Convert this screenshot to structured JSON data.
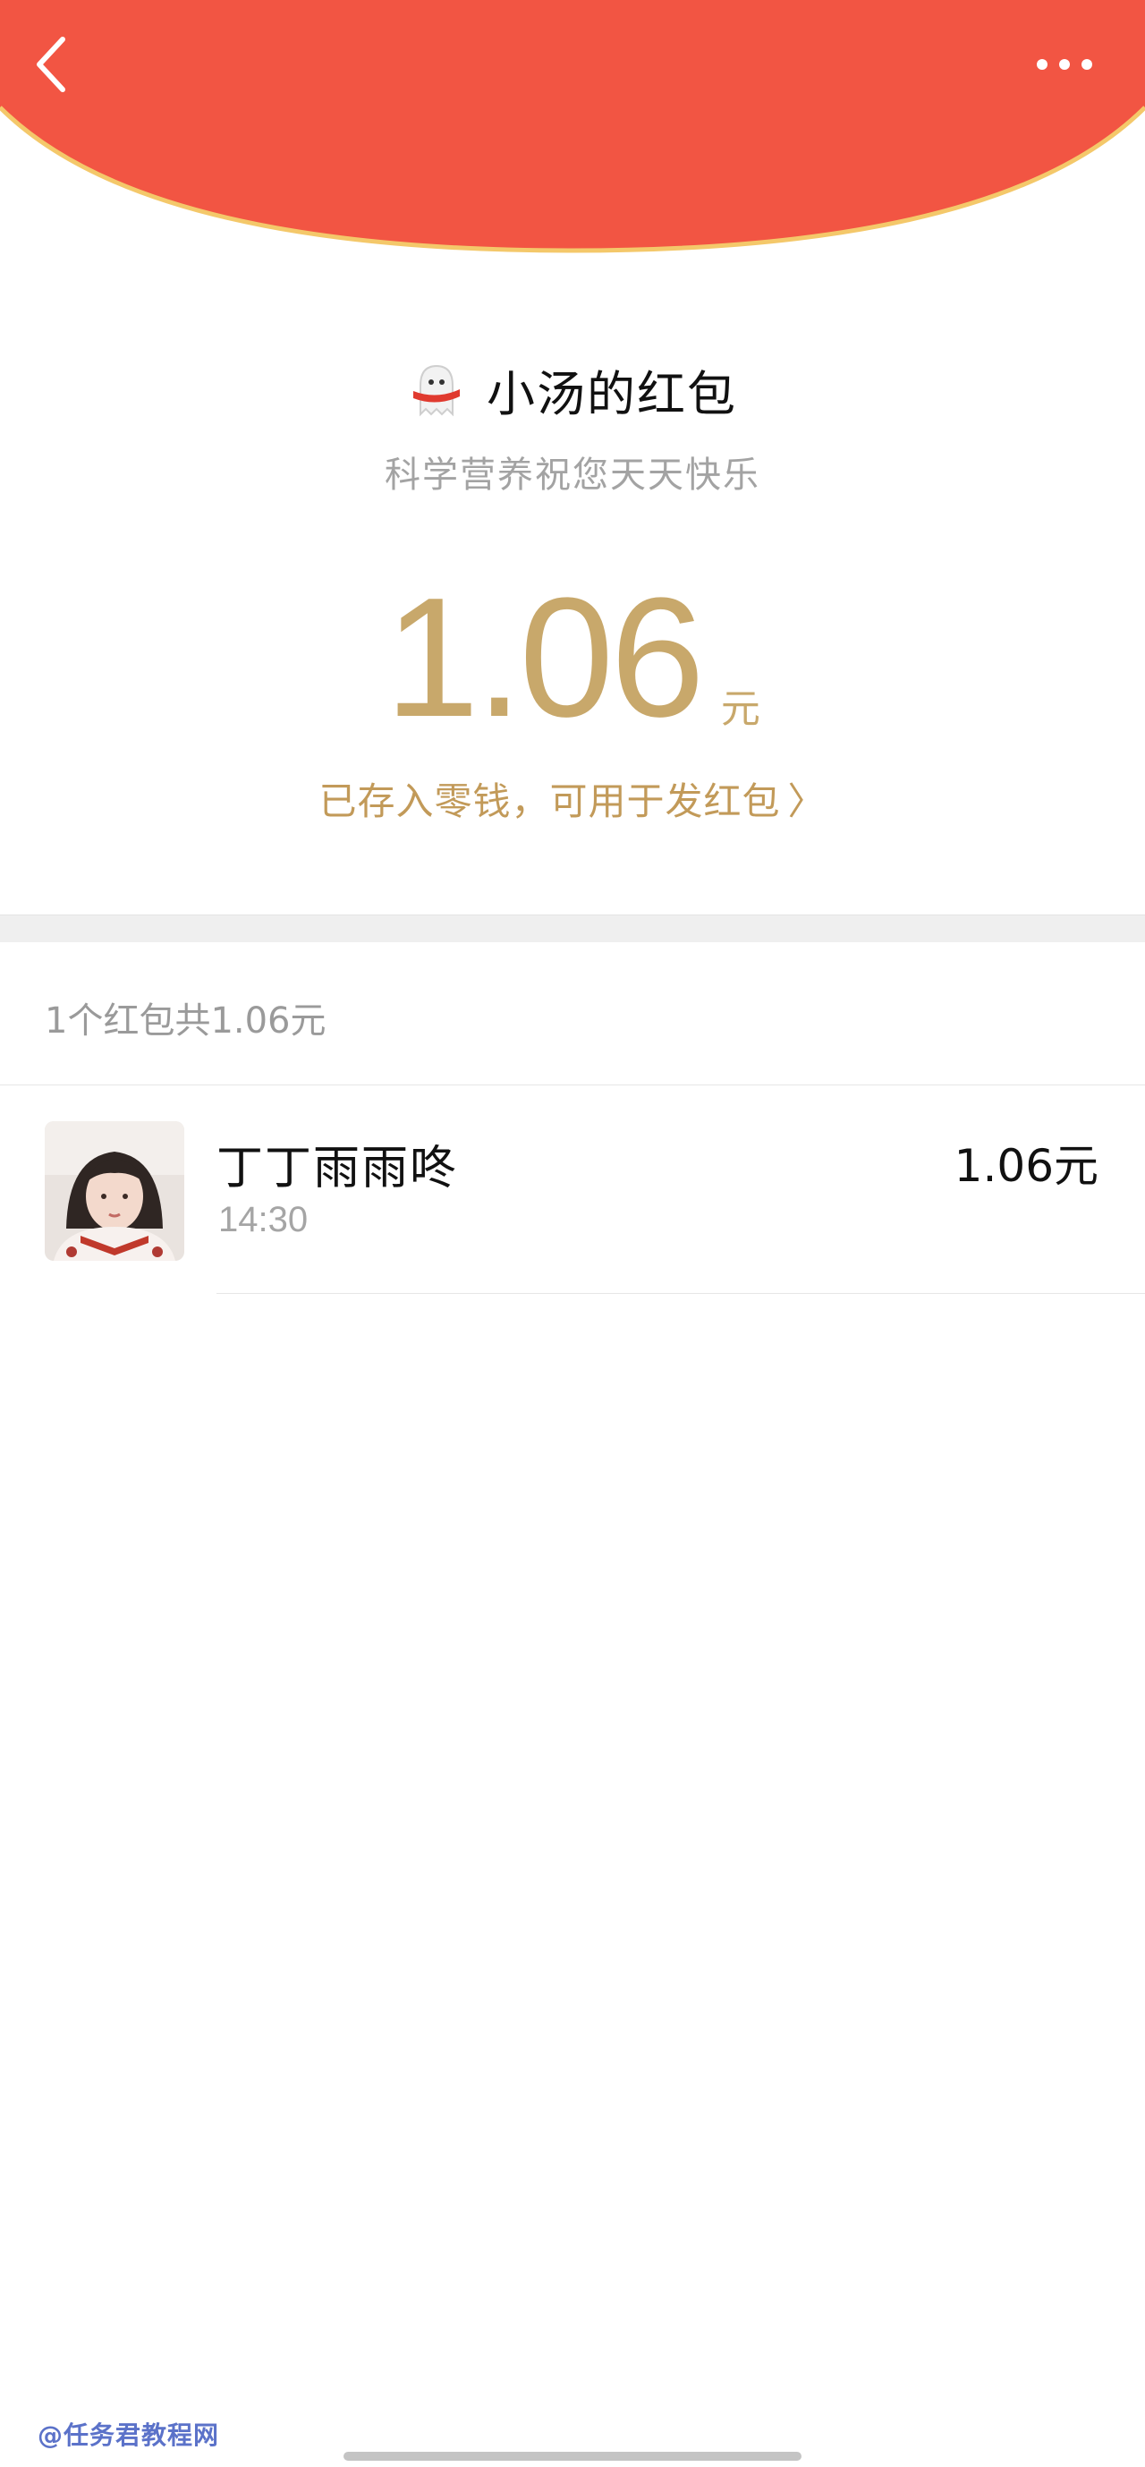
{
  "header": {
    "background_color": "#F25543",
    "edge_color": "#F4C86A",
    "back_icon": "chevron-left-icon",
    "more_icon": "more-dots-icon"
  },
  "packet": {
    "sender_avatar": "ghost-mascot-icon",
    "title": "小汤的红包",
    "greeting": "科学营养祝您天天快乐",
    "amount": "1.06",
    "amount_unit": "元",
    "saved_text": "已存入零钱，可用于发红包",
    "saved_chevron": "〉",
    "accent_color": "#C8A86B"
  },
  "summary": "1个红包共1.06元",
  "records": [
    {
      "name": "丁丁雨雨咚",
      "time": "14:30",
      "amount": "1.06元",
      "avatar": "user-avatar-photo"
    }
  ],
  "watermark": "@任务君教程网"
}
